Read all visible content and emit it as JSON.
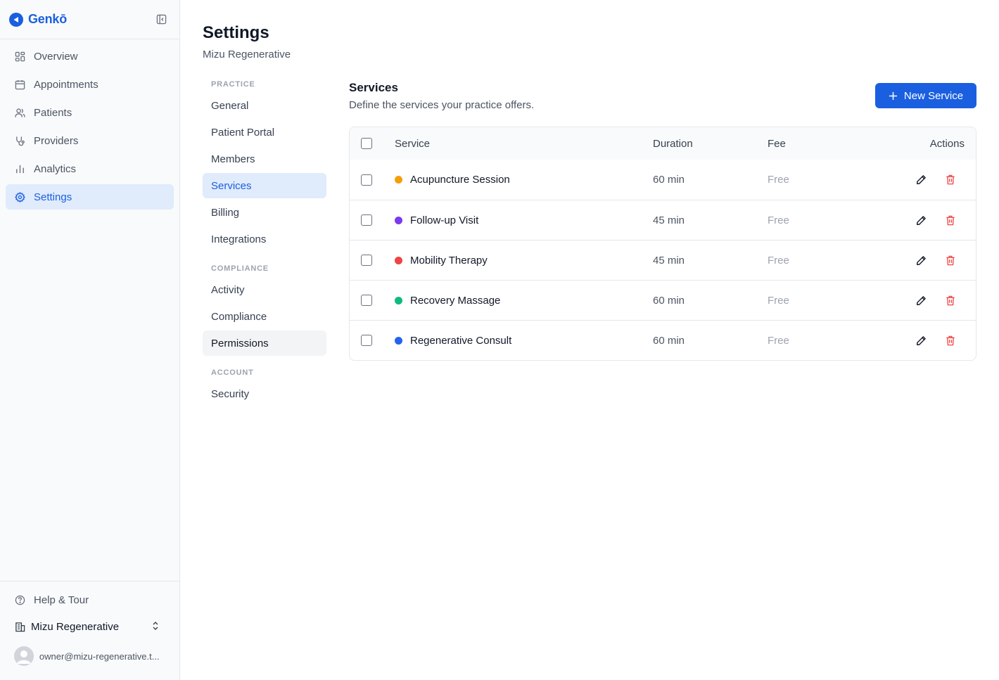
{
  "brand": {
    "name": "Genkō",
    "color": "#1a5fe0"
  },
  "sidebar": {
    "items": [
      {
        "label": "Overview",
        "icon": "dashboard-icon"
      },
      {
        "label": "Appointments",
        "icon": "calendar-icon"
      },
      {
        "label": "Patients",
        "icon": "users-icon"
      },
      {
        "label": "Providers",
        "icon": "stethoscope-icon"
      },
      {
        "label": "Analytics",
        "icon": "bar-chart-icon"
      },
      {
        "label": "Settings",
        "icon": "gear-icon",
        "active": true
      }
    ],
    "help_label": "Help & Tour",
    "org_name": "Mizu Regenerative",
    "user_email": "owner@mizu-regenerative.t..."
  },
  "page": {
    "title": "Settings",
    "subtitle": "Mizu Regenerative"
  },
  "settings_nav": {
    "practice_heading": "PRACTICE",
    "practice": [
      "General",
      "Patient Portal",
      "Members",
      "Services",
      "Billing",
      "Integrations"
    ],
    "compliance_heading": "COMPLIANCE",
    "compliance": [
      "Activity",
      "Compliance",
      "Permissions"
    ],
    "account_heading": "ACCOUNT",
    "account": [
      "Security"
    ],
    "active": "Services",
    "hovered": "Permissions"
  },
  "services": {
    "title": "Services",
    "description": "Define the services your practice offers.",
    "new_button": "New Service",
    "columns": {
      "service": "Service",
      "duration": "Duration",
      "fee": "Fee",
      "actions": "Actions"
    },
    "rows": [
      {
        "name": "Acupuncture Session",
        "duration": "60 min",
        "fee": "Free",
        "color": "#f59e0b"
      },
      {
        "name": "Follow-up Visit",
        "duration": "45 min",
        "fee": "Free",
        "color": "#7c3aed"
      },
      {
        "name": "Mobility Therapy",
        "duration": "45 min",
        "fee": "Free",
        "color": "#ef4444"
      },
      {
        "name": "Recovery Massage",
        "duration": "60 min",
        "fee": "Free",
        "color": "#10b981"
      },
      {
        "name": "Regenerative Consult",
        "duration": "60 min",
        "fee": "Free",
        "color": "#2563eb"
      }
    ]
  },
  "colors": {
    "accent": "#1a5fe0",
    "active_bg": "#e0ebfc",
    "danger": "#ef4444"
  }
}
